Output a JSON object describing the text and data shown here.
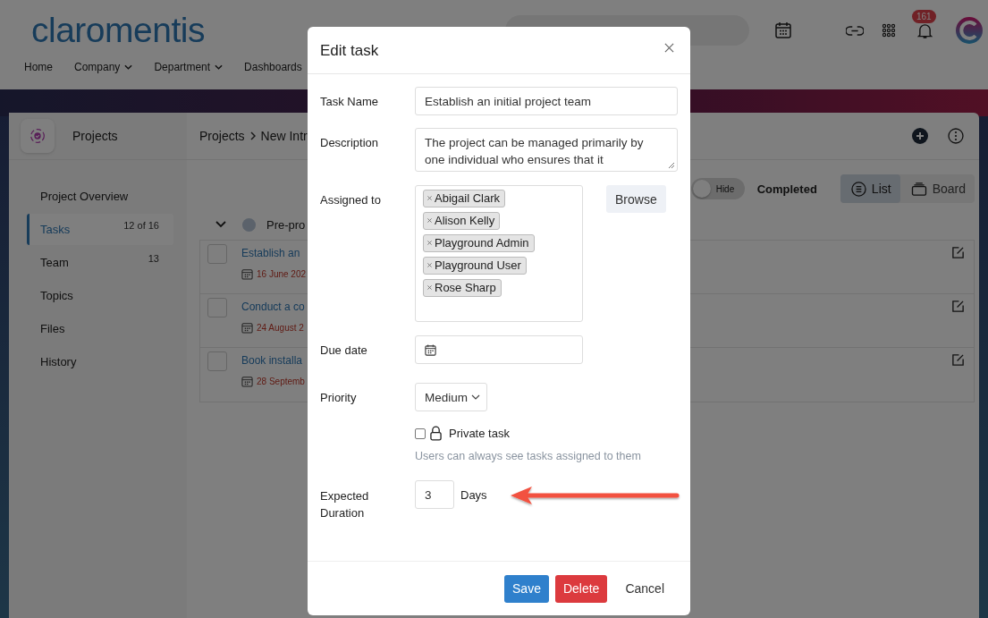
{
  "header": {
    "logo": "claromentis",
    "nav": [
      {
        "label": "Home",
        "dropdown": false
      },
      {
        "label": "Company",
        "dropdown": true
      },
      {
        "label": "Department",
        "dropdown": true
      },
      {
        "label": "Dashboards",
        "dropdown": false
      }
    ],
    "notification_count": "161"
  },
  "app": {
    "title": "Projects",
    "breadcrumb": [
      "Projects",
      "New Intr"
    ]
  },
  "sidebar": {
    "items": [
      {
        "label": "Project Overview",
        "selected": false
      },
      {
        "label": "Tasks",
        "count": "12 of 16",
        "selected": true
      },
      {
        "label": "Team",
        "count": "13",
        "selected": false
      },
      {
        "label": "Topics",
        "selected": false
      },
      {
        "label": "Files",
        "selected": false
      },
      {
        "label": "History",
        "selected": false
      }
    ]
  },
  "toolbar": {
    "toggle_label": "Hide",
    "toggle_on": false,
    "filter_label": "Completed",
    "views": [
      {
        "label": "List",
        "kind": "list",
        "selected": true
      },
      {
        "label": "Board",
        "kind": "board",
        "selected": false
      }
    ]
  },
  "group": {
    "name": "Pre-pro",
    "expanded": true
  },
  "tasks": [
    {
      "name": "Establish an",
      "due": "16 June 202",
      "done": false
    },
    {
      "name": "Conduct a co",
      "due": "24 August 2",
      "done": false
    },
    {
      "name": "Book installa",
      "due": "28 Septemb",
      "done": false
    }
  ],
  "modal": {
    "title": "Edit task",
    "task_name": {
      "label": "Task Name",
      "value": "Establish an initial project team"
    },
    "description": {
      "label": "Description",
      "value": "The project can be managed primarily by one individual who ensures that it"
    },
    "assigned_to": {
      "label": "Assigned to",
      "people": [
        "Abigail Clark",
        "Alison Kelly",
        "Playground Admin",
        "Playground User",
        "Rose Sharp"
      ],
      "browse": "Browse"
    },
    "due_date": {
      "label": "Due date"
    },
    "priority": {
      "label": "Priority",
      "value": "Medium"
    },
    "private_task": {
      "label": "Private task",
      "checked": false,
      "hint": "Users can always see tasks assigned to them"
    },
    "duration": {
      "label": "Expected Duration",
      "value": "3",
      "unit": "Days"
    },
    "buttons": [
      {
        "label": "Save",
        "kind": "primary"
      },
      {
        "label": "Delete",
        "kind": "danger"
      },
      {
        "label": "Cancel",
        "kind": "plain"
      }
    ]
  }
}
